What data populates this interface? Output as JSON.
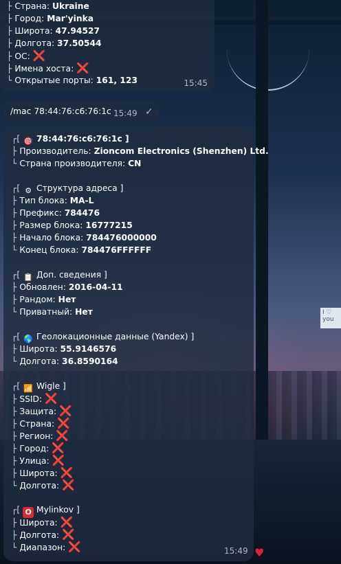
{
  "top_bubble": {
    "lines": [
      {
        "label": "Страна: ",
        "value": "Ukraine"
      },
      {
        "label": "Город: ",
        "value": "Mar'yinka"
      },
      {
        "label": "Широта: ",
        "value": "47.94527"
      },
      {
        "label": "Долгота: ",
        "value": "37.50544"
      },
      {
        "label": "ОС: ",
        "value": "❌"
      },
      {
        "label": "Имена хоста: ",
        "value": "❌"
      },
      {
        "label": "Открытые порты: ",
        "value": "161, 123"
      }
    ],
    "time": "15:45"
  },
  "outgoing": {
    "text": "/mac 78:44:76:c6:76:1c",
    "time": "15:49",
    "check": "✓"
  },
  "reply": {
    "sections": [
      {
        "icon": "target-icon",
        "glyph": "🎯",
        "title": "78:44:76:c6:76:1c ]",
        "title_bold": true,
        "lines": [
          {
            "label": "Производитель: ",
            "value": "Zioncom Electronics (Shenzhen) Ltd."
          },
          {
            "label": "Страна производителя: ",
            "value": "CN"
          }
        ]
      },
      {
        "icon": "gear-icon",
        "glyph": "⚙",
        "title": "Структура адреса ]",
        "title_bold": false,
        "lines": [
          {
            "label": "Тип блока: ",
            "value": "MA-L"
          },
          {
            "label": "Префикс: ",
            "value": "784476"
          },
          {
            "label": "Размер блока: ",
            "value": "16777215"
          },
          {
            "label": "Начало блока: ",
            "value": "784476000000"
          },
          {
            "label": "Конец блока: ",
            "value": "784476FFFFFF"
          }
        ]
      },
      {
        "icon": "clipboard-icon",
        "glyph": "📋",
        "title": "Доп. сведения ]",
        "title_bold": false,
        "lines": [
          {
            "label": "Обновлен: ",
            "value": "2016-04-11"
          },
          {
            "label": "Рандом: ",
            "value": "Нет"
          },
          {
            "label": "Приватный: ",
            "value": "Нет"
          }
        ]
      },
      {
        "icon": "globe-icon",
        "glyph": "🌎",
        "title": "Геолокационные данные (Yandex) ]",
        "title_bold": false,
        "lines": [
          {
            "label": "Широта: ",
            "value": "55.9146576"
          },
          {
            "label": "Долгота: ",
            "value": "36.8590164"
          }
        ]
      },
      {
        "icon": "signal-bars-icon",
        "glyph": "📶",
        "title": "Wigle ]",
        "title_bold": false,
        "lines": [
          {
            "label": "SSID: ",
            "value": "❌"
          },
          {
            "label": "Защита: ",
            "value": "❌"
          },
          {
            "label": "Страна: ",
            "value": "❌"
          },
          {
            "label": "Регион: ",
            "value": "❌"
          },
          {
            "label": "Город: ",
            "value": "❌"
          },
          {
            "label": "Улица: ",
            "value": "❌"
          },
          {
            "label": "Широта: ",
            "value": "❌"
          },
          {
            "label": "Долгота: ",
            "value": "❌"
          }
        ]
      },
      {
        "icon": "o-button-icon",
        "glyph": "O",
        "title": "Mylinkov ]",
        "title_bold": false,
        "lines": [
          {
            "label": "Широта: ",
            "value": "❌"
          },
          {
            "label": "Долгота: ",
            "value": "❌"
          },
          {
            "label": "Диапазон: ",
            "value": "❌"
          }
        ]
      }
    ],
    "time": "15:49",
    "reaction": "♥"
  },
  "wallpaper_note": "I ♡ you",
  "colors": {
    "bubble": "#1e2c40",
    "cross": "#e02020",
    "reaction": "#e0213b"
  }
}
